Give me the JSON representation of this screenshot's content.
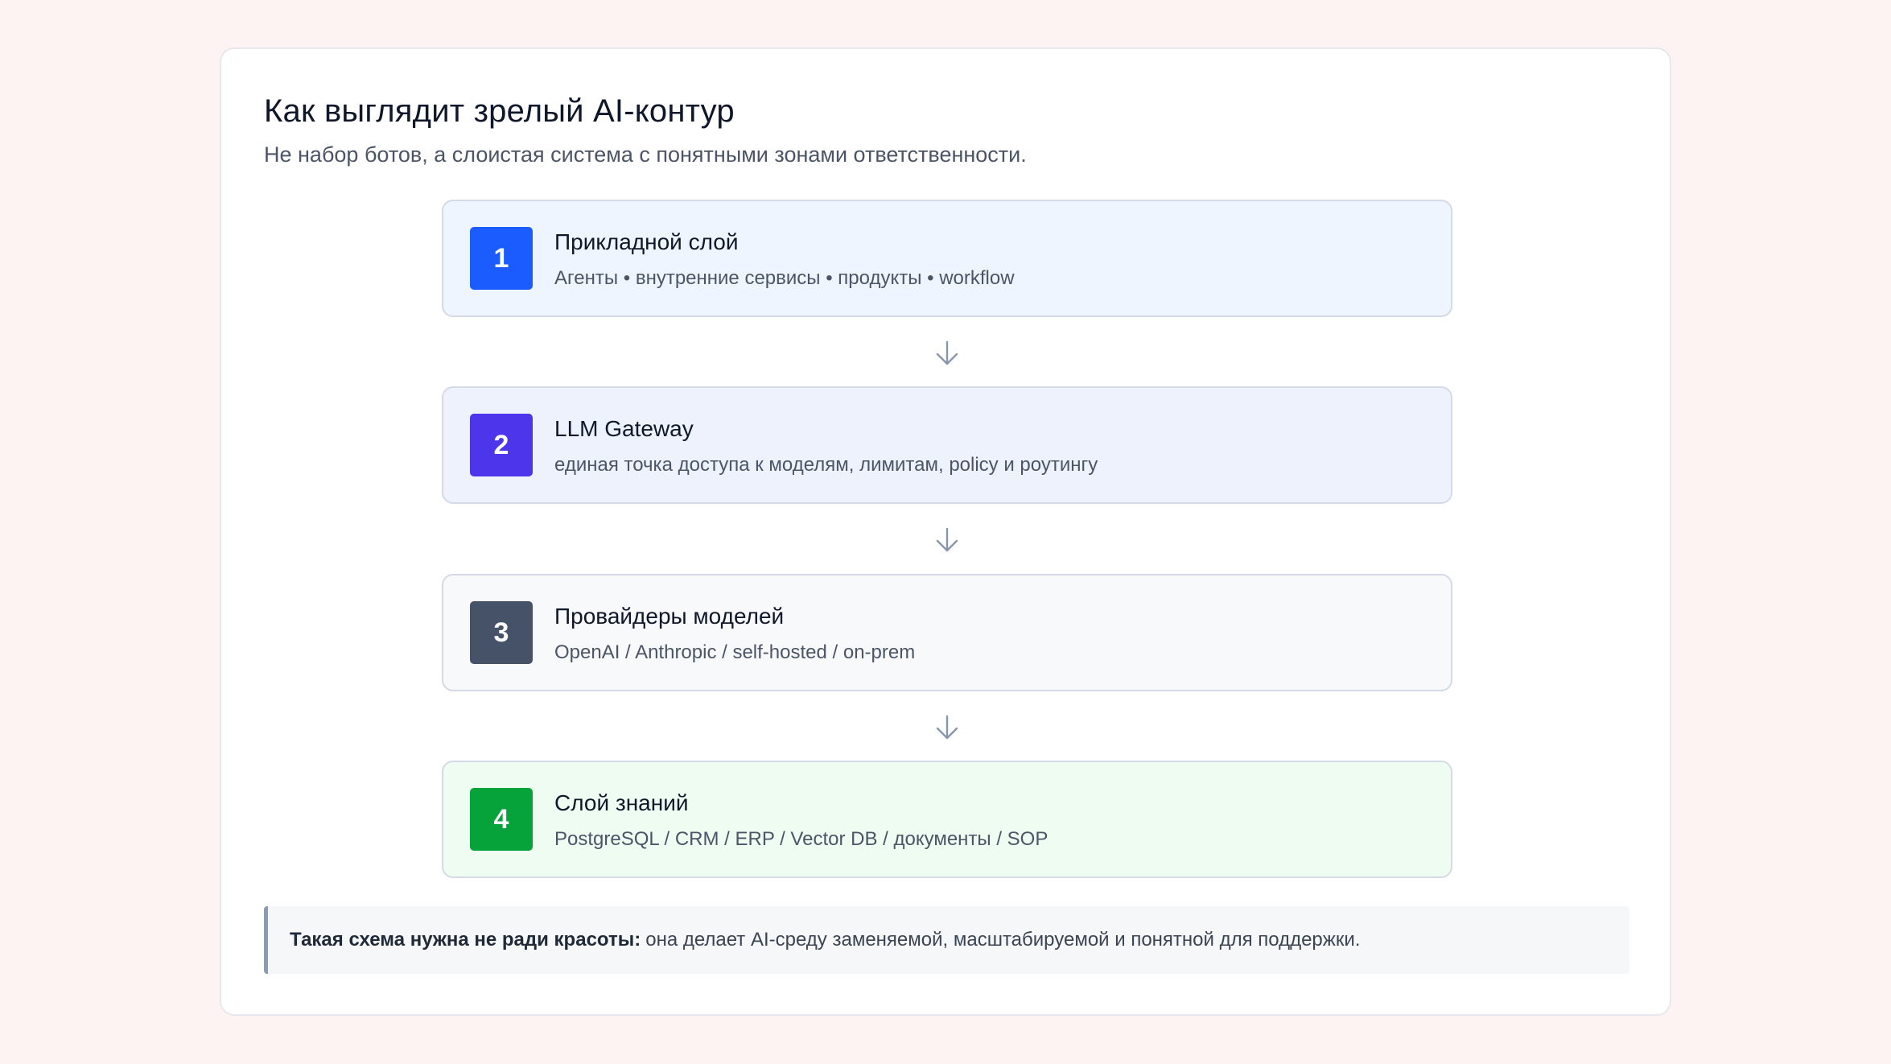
{
  "header": {
    "title": "Как выглядит зрелый AI-контур",
    "subtitle": "Не набор ботов, а слоистая система с понятными зонами ответственности."
  },
  "layers": [
    {
      "number": "1",
      "name": "Прикладной слой",
      "description": "Агенты • внутренние сервисы • продукты • workflow",
      "badge_color": "#1a5cff",
      "background": "#eef5fe"
    },
    {
      "number": "2",
      "name": "LLM Gateway",
      "description": "единая точка доступа к моделям, лимитам, policy и роутингу",
      "badge_color": "#4c35ea",
      "background": "#eef2fd"
    },
    {
      "number": "3",
      "name": "Провайдеры моделей",
      "description": "OpenAI / Anthropic / self-hosted / on-prem",
      "badge_color": "#465268",
      "background": "#f8f9fb"
    },
    {
      "number": "4",
      "name": "Слой знаний",
      "description": "PostgreSQL / CRM / ERP / Vector DB / документы / SOP",
      "badge_color": "#06a33a",
      "background": "#eefcf2"
    }
  ],
  "note": {
    "bold": "Такая схема нужна не ради красоты:",
    "text": "она делает AI-среду заменяемой, масштабируемой и понятной для поддержки."
  }
}
